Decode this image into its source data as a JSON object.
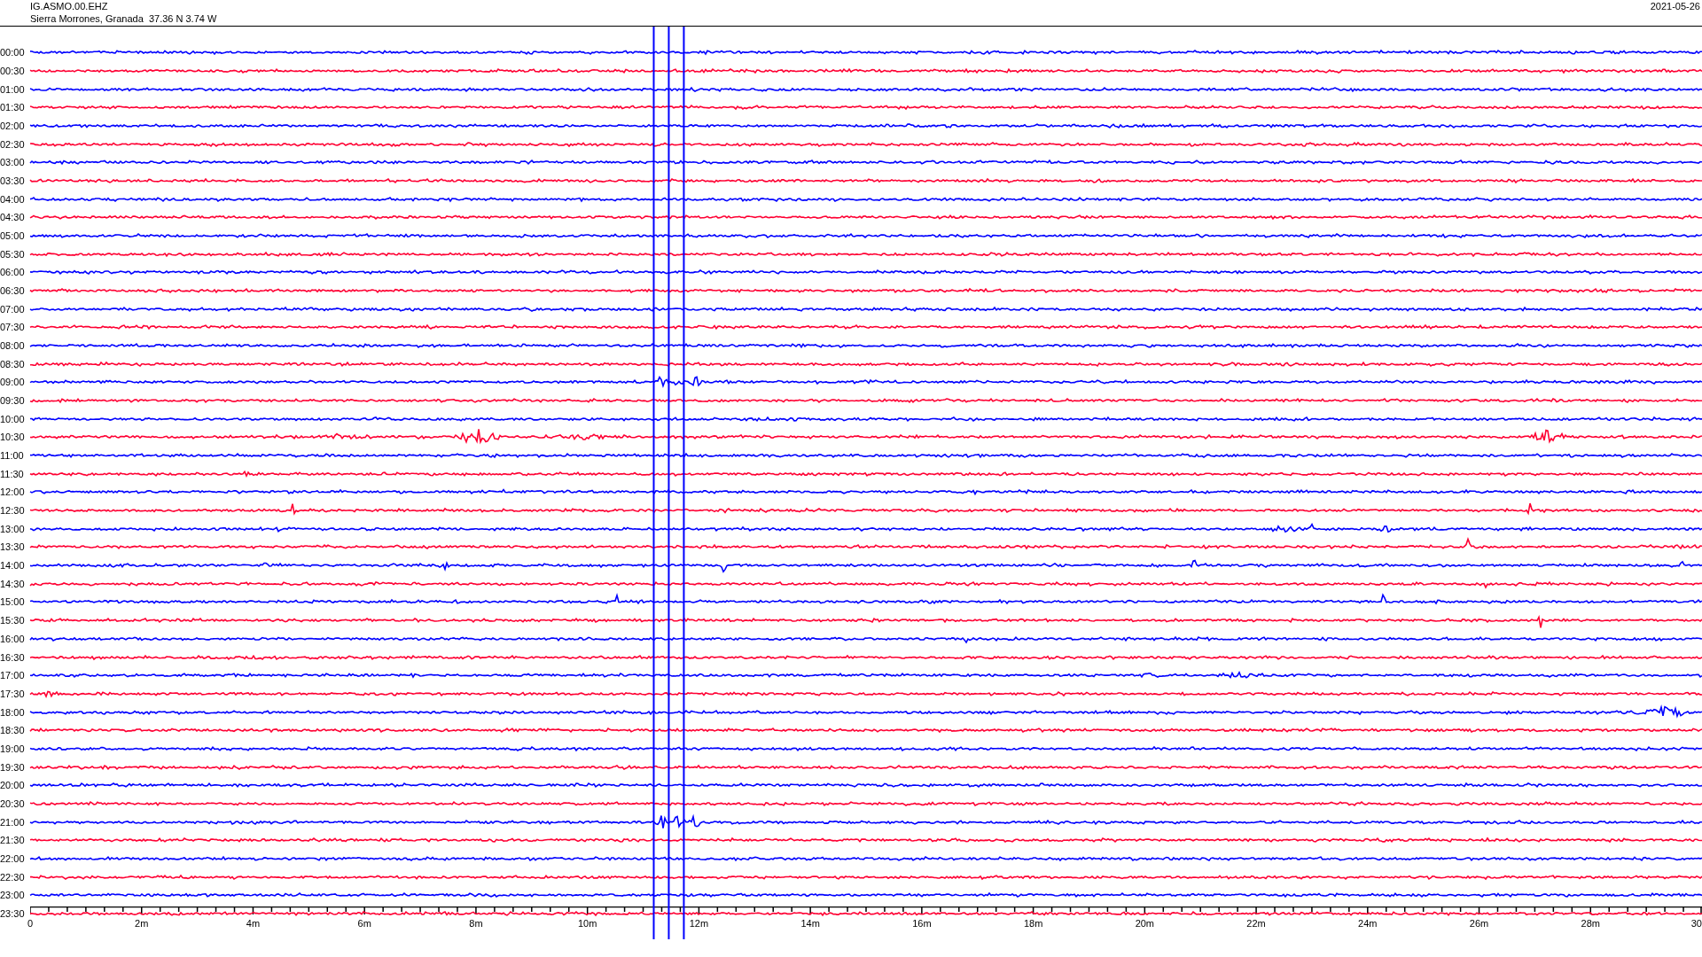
{
  "header": {
    "station": "IG.ASMO.00.EHZ",
    "location": "Sierra Morrones, Granada  37.36 N 3.74 W",
    "date": "2021-05-26"
  },
  "rows": [
    {
      "time": "00:00",
      "color": "#0000ff"
    },
    {
      "time": "00:30",
      "color": "#ff0033"
    },
    {
      "time": "01:00",
      "color": "#0000ff"
    },
    {
      "time": "01:30",
      "color": "#ff0033"
    },
    {
      "time": "02:00",
      "color": "#0000ff"
    },
    {
      "time": "02:30",
      "color": "#ff0033"
    },
    {
      "time": "03:00",
      "color": "#0000ff"
    },
    {
      "time": "03:30",
      "color": "#ff0033"
    },
    {
      "time": "04:00",
      "color": "#0000ff"
    },
    {
      "time": "04:30",
      "color": "#ff0033"
    },
    {
      "time": "05:00",
      "color": "#0000ff"
    },
    {
      "time": "05:30",
      "color": "#ff0033"
    },
    {
      "time": "06:00",
      "color": "#0000ff"
    },
    {
      "time": "06:30",
      "color": "#ff0033"
    },
    {
      "time": "07:00",
      "color": "#0000ff"
    },
    {
      "time": "07:30",
      "color": "#ff0033"
    },
    {
      "time": "08:00",
      "color": "#0000ff"
    },
    {
      "time": "08:30",
      "color": "#ff0033"
    },
    {
      "time": "09:00",
      "color": "#0000ff"
    },
    {
      "time": "09:30",
      "color": "#ff0033"
    },
    {
      "time": "10:00",
      "color": "#0000ff"
    },
    {
      "time": "10:30",
      "color": "#ff0033"
    },
    {
      "time": "11:00",
      "color": "#0000ff"
    },
    {
      "time": "11:30",
      "color": "#ff0033"
    },
    {
      "time": "12:00",
      "color": "#0000ff"
    },
    {
      "time": "12:30",
      "color": "#ff0033"
    },
    {
      "time": "13:00",
      "color": "#0000ff"
    },
    {
      "time": "13:30",
      "color": "#ff0033"
    },
    {
      "time": "14:00",
      "color": "#0000ff"
    },
    {
      "time": "14:30",
      "color": "#ff0033"
    },
    {
      "time": "15:00",
      "color": "#0000ff"
    },
    {
      "time": "15:30",
      "color": "#ff0033"
    },
    {
      "time": "16:00",
      "color": "#0000ff"
    },
    {
      "time": "16:30",
      "color": "#ff0033"
    },
    {
      "time": "17:00",
      "color": "#0000ff"
    },
    {
      "time": "17:30",
      "color": "#ff0033"
    },
    {
      "time": "18:00",
      "color": "#0000ff"
    },
    {
      "time": "18:30",
      "color": "#ff0033"
    },
    {
      "time": "19:00",
      "color": "#0000ff"
    },
    {
      "time": "19:30",
      "color": "#ff0033"
    },
    {
      "time": "20:00",
      "color": "#0000ff"
    },
    {
      "time": "20:30",
      "color": "#ff0033"
    },
    {
      "time": "21:00",
      "color": "#0000ff"
    },
    {
      "time": "21:30",
      "color": "#ff0033"
    },
    {
      "time": "22:00",
      "color": "#0000ff"
    },
    {
      "time": "22:30",
      "color": "#ff0033"
    },
    {
      "time": "23:00",
      "color": "#0000ff"
    },
    {
      "time": "23:30",
      "color": "#ff0033"
    }
  ],
  "x_axis": {
    "labels": [
      "0",
      "2m",
      "4m",
      "6m",
      "8m",
      "10m",
      "12m",
      "14m",
      "16m",
      "18m",
      "20m",
      "22m",
      "24m",
      "26m",
      "28m",
      "30"
    ]
  }
}
